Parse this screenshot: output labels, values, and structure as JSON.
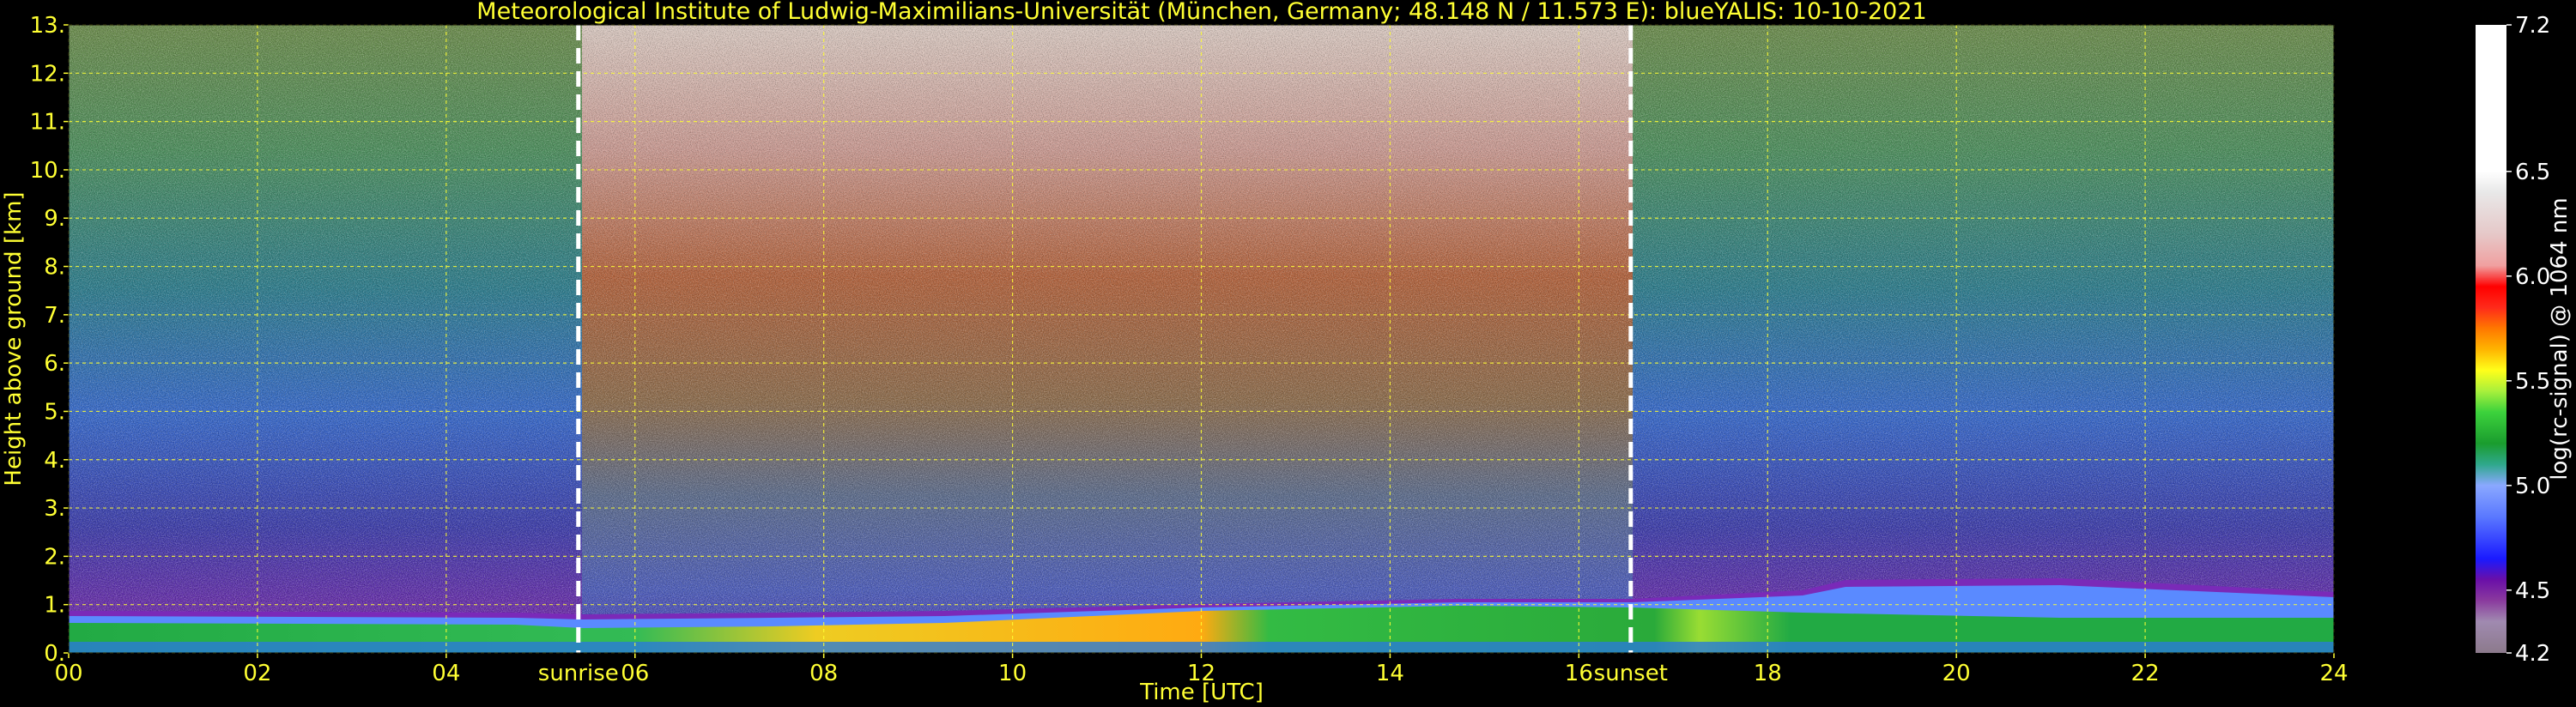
{
  "chart_data": {
    "type": "heatmap",
    "title": "Meteorological Institute of Ludwig-Maximilians-Universität (München, Germany; 48.148 N / 11.573 E):     blueYALIS: 10-10-2021",
    "xlabel": "Time [UTC]",
    "ylabel": "Height above ground [km]",
    "xlim": [
      0,
      24
    ],
    "ylim": [
      0,
      13
    ],
    "x_ticks": [
      0,
      2,
      4,
      6,
      8,
      10,
      12,
      14,
      16,
      18,
      20,
      22,
      24
    ],
    "x_tick_labels": [
      "00",
      "02",
      "04",
      "06",
      "08",
      "10",
      "12",
      "14",
      "16",
      "18",
      "20",
      "22",
      "24"
    ],
    "y_ticks": [
      0,
      1,
      2,
      3,
      4,
      5,
      6,
      7,
      8,
      9,
      10,
      11,
      12,
      13
    ],
    "y_tick_labels": [
      "0.",
      "1.",
      "2.",
      "3.",
      "4.",
      "5.",
      "6.",
      "7.",
      "8.",
      "9.",
      "10.",
      "11.",
      "12.",
      "13."
    ],
    "grid": true,
    "annotations": [
      {
        "x": 5.4,
        "label": "sunrise"
      },
      {
        "x": 16.55,
        "label": "sunset"
      }
    ],
    "colorbar": {
      "label": "log(rc-signal) @ 1064 nm",
      "range": [
        4.2,
        7.2
      ],
      "tick_values": [
        4.2,
        4.5,
        5.0,
        5.5,
        6.0,
        6.5,
        7.2
      ],
      "tick_labels": [
        "4.2",
        "4.5",
        "5.0",
        "5.5",
        "6.0",
        "6.5",
        "7.2"
      ],
      "stops": [
        {
          "v": 4.2,
          "color": "#8c7a8c"
        },
        {
          "v": 4.35,
          "color": "#a08ab0"
        },
        {
          "v": 4.45,
          "color": "#8a3a9e"
        },
        {
          "v": 4.55,
          "color": "#6a0fa8"
        },
        {
          "v": 4.65,
          "color": "#1a1aff"
        },
        {
          "v": 4.85,
          "color": "#5a78ff"
        },
        {
          "v": 5.0,
          "color": "#8aa8ff"
        },
        {
          "v": 5.1,
          "color": "#2fa88c"
        },
        {
          "v": 5.2,
          "color": "#1a9c2e"
        },
        {
          "v": 5.35,
          "color": "#3cd23c"
        },
        {
          "v": 5.45,
          "color": "#a8f03c"
        },
        {
          "v": 5.55,
          "color": "#ffff1a"
        },
        {
          "v": 5.65,
          "color": "#ffb400"
        },
        {
          "v": 5.75,
          "color": "#ff7800"
        },
        {
          "v": 5.85,
          "color": "#ff2a1a"
        },
        {
          "v": 5.95,
          "color": "#ff0000"
        },
        {
          "v": 6.05,
          "color": "#f0a0a0"
        },
        {
          "v": 6.2,
          "color": "#e6c8c8"
        },
        {
          "v": 6.4,
          "color": "#e8e8e8"
        },
        {
          "v": 6.5,
          "color": "#ffffff"
        },
        {
          "v": 7.2,
          "color": "#ffffff"
        }
      ]
    },
    "colors": {
      "text": "#ffff33",
      "grid": "#ffff33",
      "markers": "#ffffff",
      "background": "#000000"
    }
  }
}
